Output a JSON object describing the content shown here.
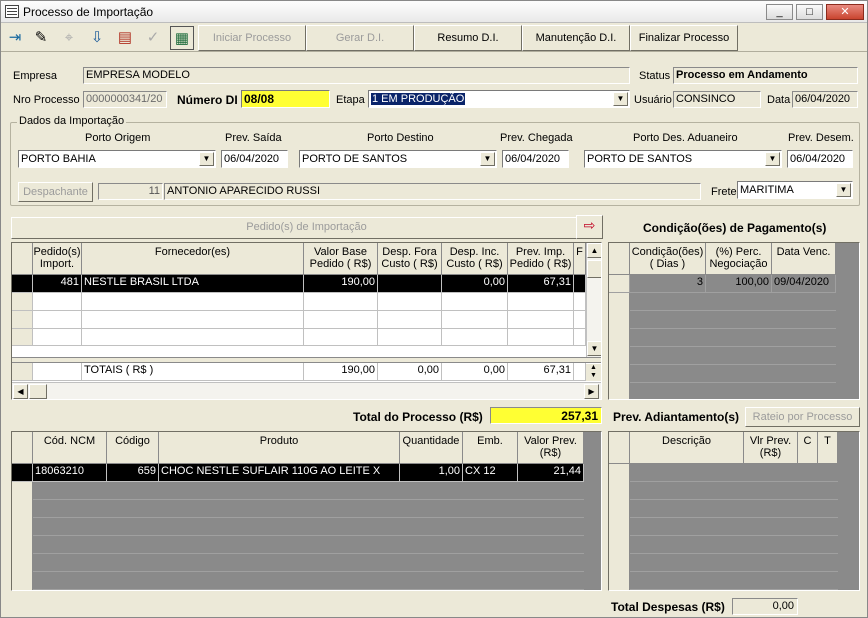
{
  "window": {
    "title": "Processo de Importação",
    "min": "_",
    "max": "□",
    "close": "✕"
  },
  "toolbar": {
    "iniciar": "Iniciar Processo",
    "gerar": "Gerar D.I.",
    "resumo": "Resumo D.I.",
    "manutencao": "Manutenção D.I.",
    "finalizar": "Finalizar Processo"
  },
  "header": {
    "empresa_label": "Empresa",
    "empresa": "EMPRESA MODELO",
    "status_label": "Status",
    "status": "Processo em Andamento",
    "nro_label": "Nro Processo",
    "nro": "0000000341/20",
    "numero_di_label": "Número DI",
    "numero_di": "08/08",
    "etapa_label": "Etapa",
    "etapa": "1 EM PRODUÇÃO",
    "usuario_label": "Usuário",
    "usuario": "CONSINCO",
    "data_label": "Data",
    "data": "06/04/2020"
  },
  "dados": {
    "group_title": "Dados da Importação",
    "porto_origem_label": "Porto Origem",
    "porto_origem": "PORTO BAHIA",
    "prev_saida_label": "Prev. Saída",
    "prev_saida": "06/04/2020",
    "porto_destino_label": "Porto Destino",
    "porto_destino": "PORTO DE SANTOS",
    "prev_chegada_label": "Prev. Chegada",
    "prev_chegada": "06/04/2020",
    "porto_aduaneiro_label": "Porto Des. Aduaneiro",
    "porto_aduaneiro": "PORTO DE SANTOS",
    "prev_desem_label": "Prev. Desem.",
    "prev_desem": "06/04/2020",
    "despachante_label": "Despachante",
    "despachante_code": "11",
    "despachante_name": "ANTONIO APARECIDO RUSSI",
    "frete_label": "Frete",
    "frete": "MARITIMA"
  },
  "pedidos": {
    "title": "Pedido(s) de Importação",
    "col1": "Pedido(s) Import.",
    "col2": "Fornecedor(es)",
    "col3": "Valor Base Pedido ( R$)",
    "col4": "Desp. Fora Custo ( R$)",
    "col5": "Desp. Inc. Custo ( R$)",
    "col6": "Prev. Imp. Pedido ( R$)",
    "col7": "F",
    "row": {
      "pedido": "481",
      "fornecedor": "NESTLE BRASIL LTDA",
      "valor": "190,00",
      "fora": "",
      "inc": "0,00",
      "prev": "67,31"
    },
    "totais_label": "TOTAIS ( R$ )",
    "tot_valor": "190,00",
    "tot_fora": "0,00",
    "tot_inc": "0,00",
    "tot_prev": "67,31"
  },
  "condicoes": {
    "title": "Condição(ões) de Pagamento(s)",
    "col1": "Condição(ões) ( Dias )",
    "col2": "(%) Perc. Negociação",
    "col3": "Data Venc.",
    "row": {
      "dias": "3",
      "perc": "100,00",
      "venc": "09/04/2020"
    }
  },
  "total_processo_label": "Total do Processo (R$)",
  "total_processo": "257,31",
  "prev_adiant_label": "Prev. Adiantamento(s)",
  "rateio": "Rateio por Processo",
  "produtos": {
    "col1": "Cód. NCM",
    "col2": "Código",
    "col3": "Produto",
    "col4": "Quantidade",
    "col5": "Emb.",
    "col6": "Valor Prev. (R$)",
    "row": {
      "ncm": "18063210",
      "codigo": "659",
      "produto": "CHOC NESTLE SUFLAIR 110G AO LEITE X",
      "qtd": "1,00",
      "emb": "CX 12",
      "valor": "21,44"
    }
  },
  "despesas": {
    "col1": "Descrição",
    "col2": "Vlr Prev. (R$)",
    "col3": "C",
    "col4": "T"
  },
  "total_despesas_label": "Total Despesas (R$)",
  "total_despesas": "0,00"
}
